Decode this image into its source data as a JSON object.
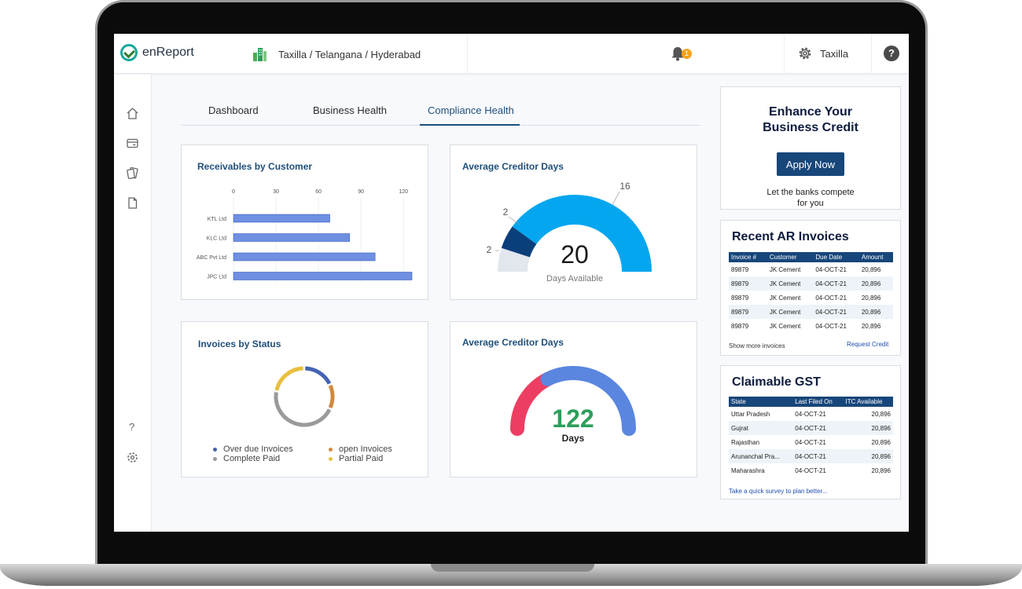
{
  "app": {
    "name": "enReport"
  },
  "location": {
    "breadcrumb": "Taxilla / Telangana  / Hyderabad"
  },
  "notifications": {
    "count": "1"
  },
  "user": {
    "name": "Taxilla"
  },
  "help": {
    "label": "?"
  },
  "sidebar": {
    "help_label": "?"
  },
  "tabs": [
    {
      "label": "Dashboard"
    },
    {
      "label": "Business Health"
    },
    {
      "label": "Compliance Health",
      "active": true
    }
  ],
  "receivables": {
    "title": "Receivables by Customer",
    "chart_data": {
      "type": "bar",
      "orientation": "horizontal",
      "categories": [
        "KTL Ltd",
        "KLC Ltd",
        "ABC Pvt Ltd",
        "JPC Ltd"
      ],
      "values": [
        68,
        82,
        100,
        126
      ],
      "xticks": [
        0,
        30,
        60,
        90,
        120
      ],
      "xlim": [
        0,
        126
      ],
      "bar_color": "#6f8fe0"
    }
  },
  "creditor_days_1": {
    "title": "Average Creditor Days",
    "value": "20",
    "caption": "Days Available",
    "chart_data": {
      "type": "pie",
      "style": "semi-donut",
      "values": [
        2,
        2,
        16
      ],
      "labels": [
        "2",
        "2",
        "16"
      ],
      "colors": [
        "#e2e7ee",
        "#0b3f7a",
        "#04a6ef"
      ]
    }
  },
  "invoices_status": {
    "title": "Invoices by Status",
    "legend": [
      {
        "label": "Over due Invoices",
        "color": "#4563b4"
      },
      {
        "label": "open Invoices",
        "color": "#d08a3c"
      },
      {
        "label": "Complete Paid",
        "color": "#9a9a9a"
      },
      {
        "label": "Partial Paid",
        "color": "#e9bf3f"
      }
    ],
    "chart_data": {
      "type": "pie",
      "style": "donut",
      "values": [
        18,
        14,
        46,
        22
      ],
      "labels": [
        "Over due Invoices",
        "open Invoices",
        "Complete Paid",
        "Partial Paid"
      ],
      "colors": [
        "#4563b4",
        "#d08a3c",
        "#9a9a9a",
        "#e9bf3f"
      ]
    }
  },
  "creditor_days_2": {
    "title": "Average Creditor Days",
    "value": "122",
    "caption": "Days",
    "value_color": "#2e9e5c",
    "chart_data": {
      "type": "pie",
      "style": "semi-donut",
      "values": [
        35,
        65
      ],
      "colors": [
        "#ec3e62",
        "#5a86df"
      ]
    }
  },
  "promo": {
    "title_line1": "Enhance Your",
    "title_line2": "Business Credit",
    "button": "Apply Now",
    "sub_line1": "Let the banks compete",
    "sub_line2": "for you"
  },
  "ar_invoices": {
    "title": "Recent AR Invoices",
    "columns": [
      "Invoice #",
      "Customer",
      "Due Date",
      "Amount"
    ],
    "rows": [
      [
        "89879",
        "JK Cement",
        "04-OCT-21",
        "20,896"
      ],
      [
        "89879",
        "JK Cement",
        "04-OCT-21",
        "20,896"
      ],
      [
        "89879",
        "JK Cement",
        "04-OCT-21",
        "20,896"
      ],
      [
        "89879",
        "JK Cement",
        "04-OCT-21",
        "20,896"
      ],
      [
        "89879",
        "JK Cement",
        "04-OCT-21",
        "20,896"
      ]
    ],
    "show_more": "Show more invoices",
    "request_credit": "Request Credit"
  },
  "gst": {
    "title": "Claimable GST",
    "columns": [
      "State",
      "Last Filed On",
      "ITC Available"
    ],
    "rows": [
      [
        "Uttar Pradesh",
        "04-OCT-21",
        "20,896"
      ],
      [
        "Gujrat",
        "04-OCT-21",
        "20,896"
      ],
      [
        "Rajasthan",
        "04-OCT-21",
        "20,896"
      ],
      [
        "Arunanchal Pra...",
        "04-OCT-21",
        "20,896"
      ],
      [
        "Maharashra",
        "04-OCT-21",
        "20,896"
      ]
    ],
    "survey_link": "Take a quick survey to plan better..."
  },
  "colors": {
    "brand_blue": "#17467a",
    "title_blue": "#1f4f7a"
  }
}
